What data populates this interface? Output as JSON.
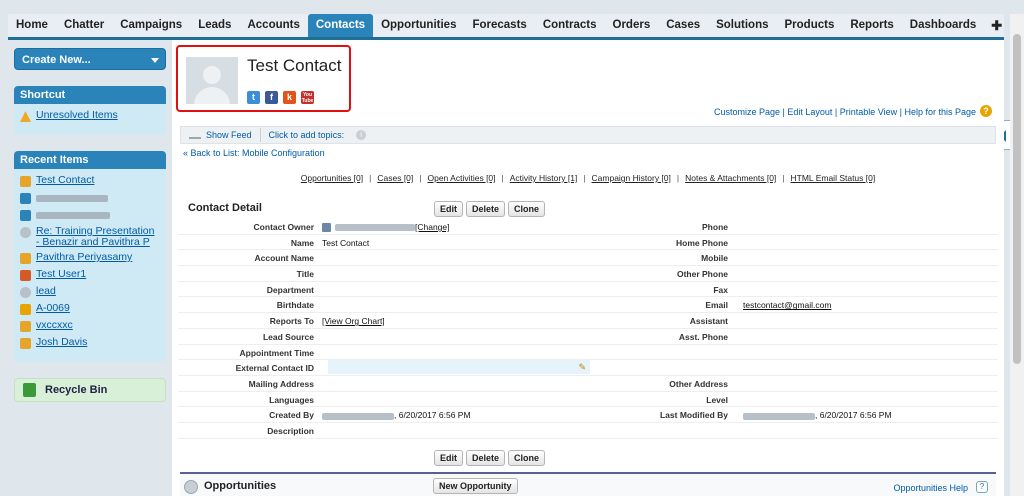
{
  "tabs": [
    {
      "label": "Home",
      "active": false
    },
    {
      "label": "Chatter",
      "active": false
    },
    {
      "label": "Campaigns",
      "active": false
    },
    {
      "label": "Leads",
      "active": false
    },
    {
      "label": "Accounts",
      "active": false
    },
    {
      "label": "Contacts",
      "active": true
    },
    {
      "label": "Opportunities",
      "active": false
    },
    {
      "label": "Forecasts",
      "active": false
    },
    {
      "label": "Contracts",
      "active": false
    },
    {
      "label": "Orders",
      "active": false
    },
    {
      "label": "Cases",
      "active": false
    },
    {
      "label": "Solutions",
      "active": false
    },
    {
      "label": "Products",
      "active": false
    },
    {
      "label": "Reports",
      "active": false
    },
    {
      "label": "Dashboards",
      "active": false
    }
  ],
  "tab_extra": {
    "plus": "✚",
    "more": "▼"
  },
  "sidebar": {
    "create_new": "Create New...",
    "shortcut_title": "Shortcut",
    "shortcut_items": [
      {
        "label": "Unresolved Items",
        "icon": "warning-icon"
      }
    ],
    "recent_title": "Recent Items",
    "recent_items": [
      {
        "label": "Test Contact",
        "icon": "contact-icon",
        "blurred": false
      },
      {
        "label": "",
        "icon": "user-icon",
        "blurred": true
      },
      {
        "label": "",
        "icon": "user-icon",
        "blurred": true
      },
      {
        "label": "Re: Training Presentation - Benazir and Pavithra P",
        "icon": "opportunity-icon",
        "blurred": false
      },
      {
        "label": "Pavithra Periyasamy",
        "icon": "contact-icon",
        "blurred": false
      },
      {
        "label": "Test User1",
        "icon": "user-group-icon",
        "blurred": false
      },
      {
        "label": "lead",
        "icon": "opportunity-icon",
        "blurred": false
      },
      {
        "label": "A-0069",
        "icon": "box-icon",
        "blurred": false
      },
      {
        "label": "vxccxxc",
        "icon": "contact-icon",
        "blurred": false
      },
      {
        "label": "Josh Davis",
        "icon": "contact-icon",
        "blurred": false
      }
    ],
    "recycle_bin": "Recycle Bin"
  },
  "header": {
    "title": "Test Contact",
    "social": [
      "t",
      "f",
      "k",
      "You Tube"
    ],
    "links": "Customize Page | Edit Layout | Printable View | Help for this Page",
    "help_icon": "?"
  },
  "feed": {
    "show_feed": "Show Feed",
    "topics": "Click to add topics:",
    "info": "i"
  },
  "back_link": "« Back to List: Mobile Configuration",
  "related_links": [
    "Opportunities [0]",
    "Cases [0]",
    "Open Activities [0]",
    "Activity History [1]",
    "Campaign History [0]",
    "Notes & Attachments [0]",
    "HTML Email Status [0]"
  ],
  "detail": {
    "title": "Contact Detail",
    "buttons": {
      "edit": "Edit",
      "delete": "Delete",
      "clone": "Clone"
    },
    "rows": [
      {
        "l1": "Contact Owner",
        "v1": "[Change]",
        "l2": "Phone",
        "v2": ""
      },
      {
        "l1": "Name",
        "v1": "Test Contact",
        "l2": "Home Phone",
        "v2": ""
      },
      {
        "l1": "Account Name",
        "v1": "",
        "l2": "Mobile",
        "v2": ""
      },
      {
        "l1": "Title",
        "v1": "",
        "l2": "Other Phone",
        "v2": ""
      },
      {
        "l1": "Department",
        "v1": "",
        "l2": "Fax",
        "v2": ""
      },
      {
        "l1": "Birthdate",
        "v1": "",
        "l2": "Email",
        "v2": "testcontact@gmail.com"
      },
      {
        "l1": "Reports To",
        "v1": "[View Org Chart]",
        "l2": "Assistant",
        "v2": ""
      },
      {
        "l1": "Lead Source",
        "v1": "",
        "l2": "Asst. Phone",
        "v2": ""
      },
      {
        "l1": "Appointment Time",
        "v1": "",
        "l2": "",
        "v2": ""
      },
      {
        "l1": "External Contact ID",
        "v1": "",
        "l2": "",
        "v2": ""
      },
      {
        "l1": "Mailing Address",
        "v1": "",
        "l2": "Other Address",
        "v2": ""
      },
      {
        "l1": "Languages",
        "v1": "",
        "l2": "Level",
        "v2": ""
      },
      {
        "l1": "Created By",
        "v1": ", 6/20/2017 6:56 PM",
        "l2": "Last Modified By",
        "v2": ", 6/20/2017 6:56 PM"
      },
      {
        "l1": "Description",
        "v1": "",
        "l2": "",
        "v2": ""
      }
    ]
  },
  "opportunities": {
    "title": "Opportunities",
    "new_button": "New Opportunity",
    "help": "Opportunities Help",
    "help_icon": "?"
  },
  "colors": {
    "brand": "#2a84ba",
    "highlight_border": "#e01010",
    "link": "#015ba7"
  }
}
